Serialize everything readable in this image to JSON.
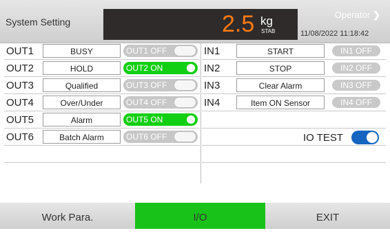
{
  "header": {
    "title": "System Setting",
    "weight": "2.5",
    "unit": "kg",
    "status": "STAB",
    "datetime": "11/08/2022  11:18:42",
    "operator": "Operator",
    "operator_chevron": "❯"
  },
  "outputs": [
    {
      "label": "OUT1",
      "name": "BUSY",
      "state": "OUT1 OFF",
      "on": false
    },
    {
      "label": "OUT2",
      "name": "HOLD",
      "state": "OUT2 ON",
      "on": true
    },
    {
      "label": "OUT3",
      "name": "Qualified",
      "state": "OUT3 OFF",
      "on": false
    },
    {
      "label": "OUT4",
      "name": "Over/Under",
      "state": "OUT4 OFF",
      "on": false
    },
    {
      "label": "OUT5",
      "name": "Alarm",
      "state": "OUT5 ON",
      "on": true
    },
    {
      "label": "OUT6",
      "name": "Batch Alarm",
      "state": "OUT6 OFF",
      "on": false
    }
  ],
  "inputs": [
    {
      "label": "IN1",
      "name": "START",
      "state": "IN1 OFF"
    },
    {
      "label": "IN2",
      "name": "STOP",
      "state": "IN2 OFF"
    },
    {
      "label": "IN3",
      "name": "Clear Alarm",
      "state": "IN3 OFF"
    },
    {
      "label": "IN4",
      "name": "Item ON Sensor",
      "state": "IN4 OFF"
    }
  ],
  "io_test": {
    "label": "IO TEST",
    "on": true
  },
  "tabs": [
    {
      "label": "Work Para.",
      "active": false
    },
    {
      "label": "I/O",
      "active": true
    },
    {
      "label": "EXIT",
      "active": false
    }
  ],
  "colors": {
    "on": "#13cf13",
    "off": "#c7c7c7",
    "accent_weight": "#ff7a12",
    "toggle_blue": "#1565c0"
  }
}
